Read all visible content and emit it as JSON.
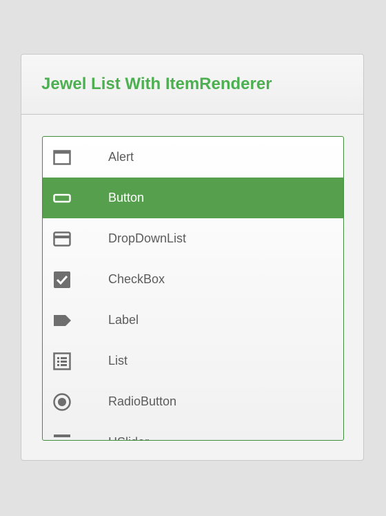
{
  "header": {
    "title": "Jewel List With ItemRenderer"
  },
  "list": {
    "selected_index": 1,
    "items": [
      {
        "label": "Alert",
        "icon": "alert-window-icon"
      },
      {
        "label": "Button",
        "icon": "button-icon"
      },
      {
        "label": "DropDownList",
        "icon": "dropdown-list-icon"
      },
      {
        "label": "CheckBox",
        "icon": "checkbox-icon"
      },
      {
        "label": "Label",
        "icon": "label-tag-icon"
      },
      {
        "label": "List",
        "icon": "list-icon"
      },
      {
        "label": "RadioButton",
        "icon": "radio-button-icon"
      },
      {
        "label": "HSlider",
        "icon": "slider-icon"
      }
    ]
  },
  "colors": {
    "accent": "#4caf50",
    "selected_row": "#56a04d",
    "icon": "#6e6e6e",
    "text": "#5c5c5c"
  }
}
